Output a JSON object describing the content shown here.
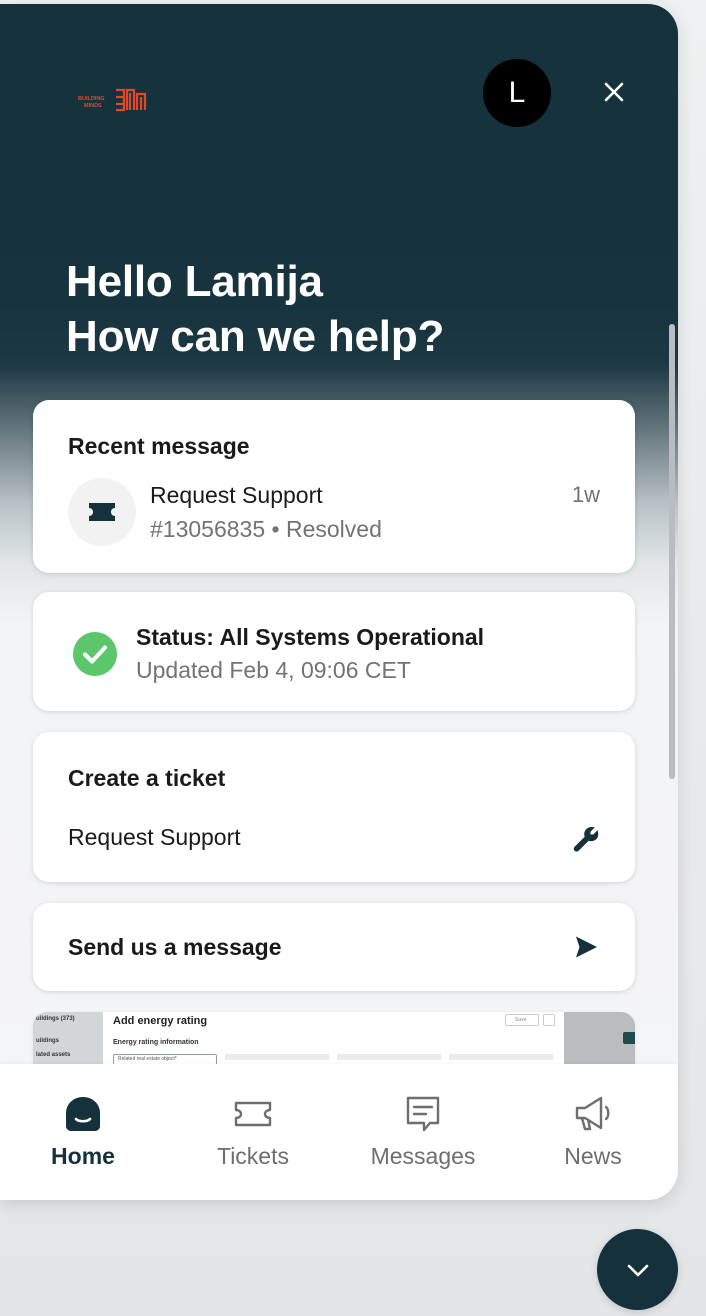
{
  "brand": {
    "logo_text_line1": "BUILDING",
    "logo_text_line2": "MINDS",
    "accent": "#e0482b"
  },
  "header": {
    "avatar_initial": "L"
  },
  "greeting": {
    "line1": "Hello Lamija",
    "line2": "How can we help?"
  },
  "recent_message": {
    "title": "Recent message",
    "item_title": "Request Support",
    "ticket_number": "#13056835",
    "separator": " • ",
    "status": "Resolved",
    "time": "1w"
  },
  "system_status": {
    "title": "Status: All Systems Operational",
    "updated": "Updated Feb 4, 09:06 CET",
    "color": "#5cc76a"
  },
  "create_ticket": {
    "title": "Create a ticket",
    "item": "Request Support"
  },
  "send_message": {
    "title": "Send us a message"
  },
  "news_preview": {
    "sidebar_lines": [
      "uildings (373)",
      "uildings",
      "lated assets"
    ],
    "title": "Add energy rating",
    "subtitle": "Energy rating information",
    "field_hint": "Related real estate object*",
    "save": "Save"
  },
  "tabs": [
    {
      "label": "Home",
      "icon": "home-icon",
      "active": true
    },
    {
      "label": "Tickets",
      "icon": "ticket-icon",
      "active": false
    },
    {
      "label": "Messages",
      "icon": "messages-icon",
      "active": false
    },
    {
      "label": "News",
      "icon": "megaphone-icon",
      "active": false
    }
  ],
  "colors": {
    "primary": "#15313c",
    "text_muted": "#737373"
  }
}
